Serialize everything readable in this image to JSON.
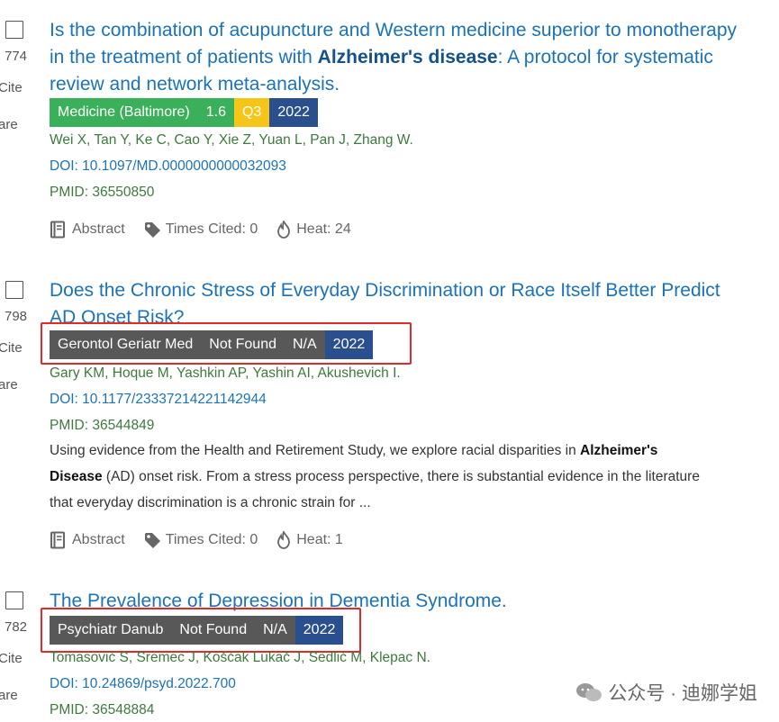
{
  "results": [
    {
      "side": {
        "num": "774",
        "cite": "Cite",
        "share": "are"
      },
      "title_parts": [
        {
          "t": "Is the combination of acupuncture and Western medicine superior to monotherapy in the treatment of patients with ",
          "b": false
        },
        {
          "t": "Alzheimer's disease",
          "b": true
        },
        {
          "t": ": A protocol for systematic review and network meta-analysis.",
          "b": false
        }
      ],
      "badges": [
        {
          "text": "Medicine (Baltimore)",
          "color": "#3bb05a"
        },
        {
          "text": "1.6",
          "color": "#3bb05a"
        },
        {
          "text": "Q3",
          "color": "#f5c518"
        },
        {
          "text": "2022",
          "color": "#2a4f8f"
        }
      ],
      "authors": "Wei X, Tan Y, Ke C, Cao Y, Xie Z, Yuan L, Pan J, Zhang W.",
      "doi": "DOI: 10.1097/MD.0000000000032093",
      "pmid": "PMID: 36550850",
      "abstract_lines": [],
      "actions": {
        "abstract": "Abstract",
        "cited": "Times Cited: 0",
        "heat": "Heat: 24"
      }
    },
    {
      "side": {
        "num": "798",
        "cite": "Cite",
        "share": "are"
      },
      "title_parts": [
        {
          "t": "Does the Chronic Stress of Everyday Discrimination or Race Itself Better Predict AD Onset Risk?",
          "b": false
        }
      ],
      "badges": [
        {
          "text": "Gerontol Geriatr Med",
          "color": "#585858"
        },
        {
          "text": "Not Found",
          "color": "#585858"
        },
        {
          "text": "N/A",
          "color": "#585858"
        },
        {
          "text": "2022",
          "color": "#2a4f8f"
        }
      ],
      "authors": "Gary KM, Hoque M, Yashkin AP, Yashin AI, Akushevich I.",
      "doi": "DOI: 10.1177/23337214221142944",
      "pmid": "PMID: 36544849",
      "abstract_lines": [
        [
          {
            "t": "Using evidence from the Health and Retirement Study, we explore racial disparities in ",
            "b": false
          },
          {
            "t": "Alzheimer's",
            "b": true
          }
        ],
        [
          {
            "t": "Disease",
            "b": true
          },
          {
            "t": " (AD) onset risk. From a stress process perspective, there is substantial evidence in the literature",
            "b": false
          }
        ],
        [
          {
            "t": "that everyday discrimination is a chronic strain for ...",
            "b": false
          }
        ]
      ],
      "actions": {
        "abstract": "Abstract",
        "cited": "Times Cited: 0",
        "heat": "Heat: 1"
      }
    },
    {
      "side": {
        "num": "782",
        "cite": "Cite",
        "share": "are"
      },
      "title_parts": [
        {
          "t": "The Prevalence of Depression in Dementia Syndrome.",
          "b": false
        }
      ],
      "badges": [
        {
          "text": "Psychiatr Danub",
          "color": "#585858"
        },
        {
          "text": "Not Found",
          "color": "#585858"
        },
        {
          "text": "N/A",
          "color": "#585858"
        },
        {
          "text": "2022",
          "color": "#2a4f8f"
        }
      ],
      "authors": "Tomasović S, Sremec J, Košćak Lukač J, Sedlić M, Klepac N.",
      "doi": "DOI: 10.24869/psyd.2022.700",
      "pmid": "PMID: 36548884",
      "abstract_lines": [],
      "actions": null
    }
  ],
  "watermark": "公众号 · 迪娜学姐",
  "colors": {
    "highlight_box": "#e02b2b",
    "link": "#1a73b8",
    "meta_green": "#3d7a3d"
  }
}
